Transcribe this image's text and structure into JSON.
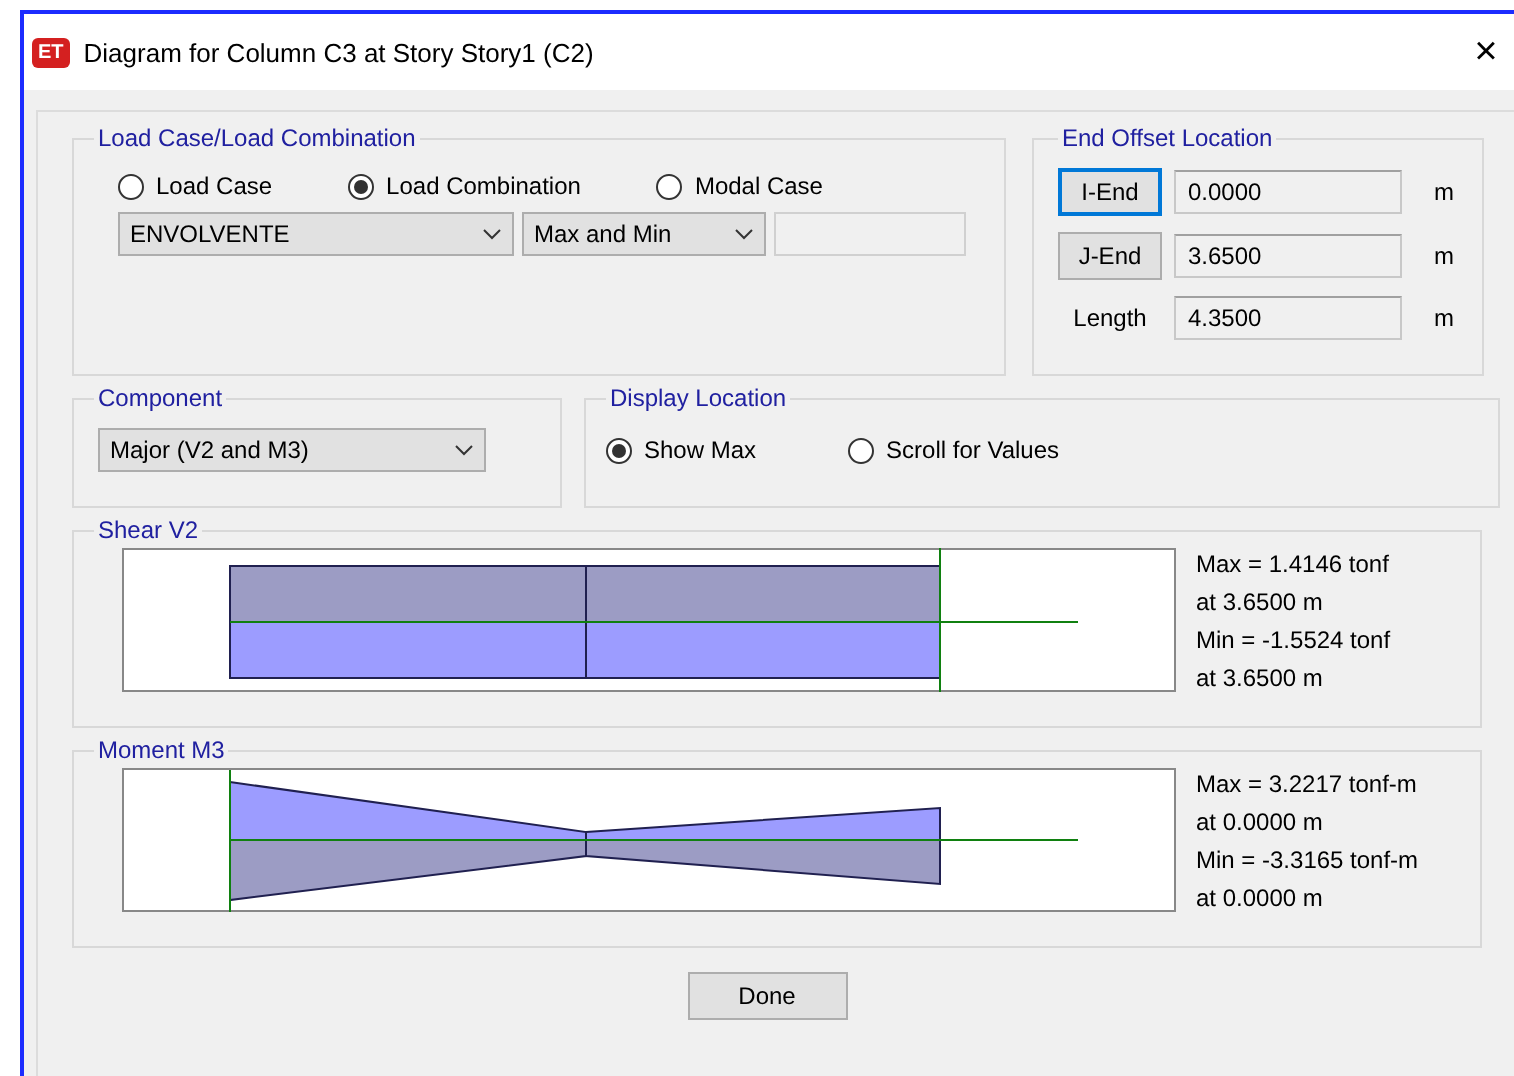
{
  "window": {
    "title": "Diagram for Column C3 at Story Story1 (C2)",
    "close": "×",
    "app_badge": "ET"
  },
  "load_case": {
    "title": "Load Case/Load Combination",
    "options": [
      {
        "label": "Load Case",
        "selected": false
      },
      {
        "label": "Load Combination",
        "selected": true
      },
      {
        "label": "Modal Case",
        "selected": false
      }
    ],
    "combo": "ENVOLVENTE",
    "mode": "Max and Min"
  },
  "end_offset": {
    "title": "End Offset Location",
    "rows": [
      {
        "kind": "button",
        "label": "I-End",
        "value": "0.0000",
        "unit": "m",
        "focused": true
      },
      {
        "kind": "button",
        "label": "J-End",
        "value": "3.6500",
        "unit": "m",
        "focused": false
      },
      {
        "kind": "label",
        "label": "Length",
        "value": "4.3500",
        "unit": "m"
      }
    ]
  },
  "component": {
    "title": "Component",
    "value": "Major (V2 and M3)"
  },
  "display_location": {
    "title": "Display Location",
    "options": [
      {
        "label": "Show Max",
        "selected": true
      },
      {
        "label": "Scroll for Values",
        "selected": false
      }
    ]
  },
  "diagrams": [
    {
      "kind": "shear",
      "title": "Shear V2",
      "lines": [
        "Max = 1.4146 tonf",
        "at 3.6500 m",
        "Min = -1.5524 tonf",
        "at 3.6500 m"
      ]
    },
    {
      "kind": "moment",
      "title": "Moment M3",
      "lines": [
        "Max = 3.2217 tonf-m",
        "at 0.0000 m",
        "Min = -3.3165 tonf-m",
        "at 0.0000 m"
      ]
    }
  ],
  "done_button": "Done"
}
